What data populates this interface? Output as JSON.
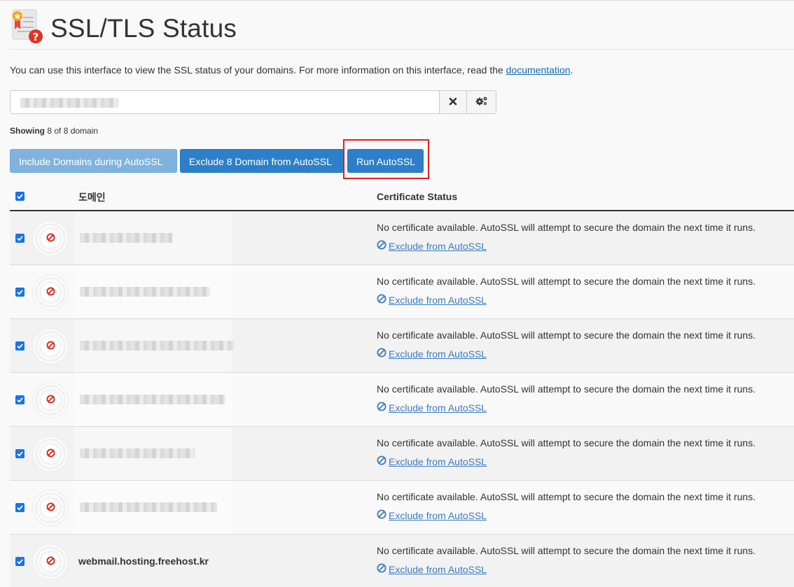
{
  "page": {
    "title": "SSL/TLS Status",
    "intro_text": "You can use this interface to view the SSL status of your domains. For more information on this interface, read the ",
    "intro_link": "documentation",
    "intro_end": "."
  },
  "search": {
    "clear_icon": "close-icon",
    "options_icon": "gears-icon"
  },
  "showing": {
    "label": "Showing",
    "count_text": "8 of 8 domain"
  },
  "actions": {
    "include_label": "Include Domains during AutoSSL",
    "exclude_label": "Exclude 8 Domain from AutoSSL",
    "run_label": "Run AutoSSL"
  },
  "table": {
    "col_domain": "도메인",
    "col_status": "Certificate Status",
    "rows": [
      {
        "domain": "",
        "status": "No certificate available. AutoSSL will attempt to secure the domain the next time it runs.",
        "action": "Exclude from AutoSSL"
      },
      {
        "domain": "",
        "status": "No certificate available. AutoSSL will attempt to secure the domain the next time it runs.",
        "action": "Exclude from AutoSSL"
      },
      {
        "domain": "",
        "status": "No certificate available. AutoSSL will attempt to secure the domain the next time it runs.",
        "action": "Exclude from AutoSSL"
      },
      {
        "domain": "",
        "status": "No certificate available. AutoSSL will attempt to secure the domain the next time it runs.",
        "action": "Exclude from AutoSSL"
      },
      {
        "domain": "",
        "status": "No certificate available. AutoSSL will attempt to secure the domain the next time it runs.",
        "action": "Exclude from AutoSSL"
      },
      {
        "domain": "",
        "status": "No certificate available. AutoSSL will attempt to secure the domain the next time it runs.",
        "action": "Exclude from AutoSSL"
      },
      {
        "domain": "webmail.hosting.freehost.kr",
        "status": "No certificate available. AutoSSL will attempt to secure the domain the next time it runs.",
        "action": "Exclude from AutoSSL"
      }
    ]
  },
  "colors": {
    "primary": "#2d7fc9",
    "primary_light": "#7fb3de",
    "link": "#3a7bbf",
    "danger": "#d9261c",
    "highlight": "#e02020"
  }
}
